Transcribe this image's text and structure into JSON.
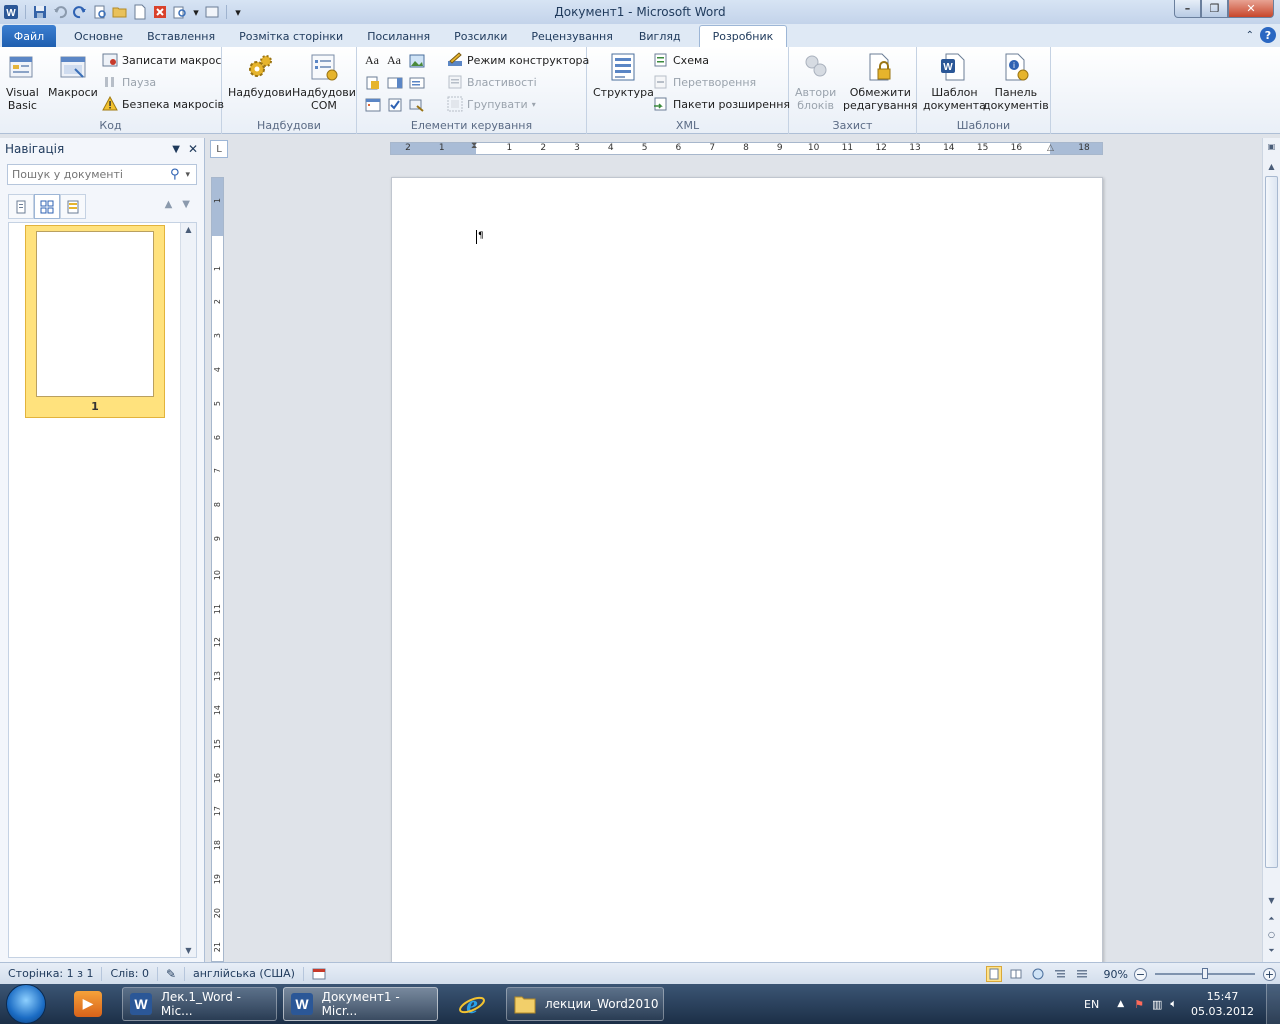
{
  "window": {
    "title": "Документ1  -  Microsoft Word"
  },
  "tabs": {
    "file": "Файл",
    "items": [
      "Основне",
      "Вставлення",
      "Розмітка сторінки",
      "Посилання",
      "Розсилки",
      "Рецензування",
      "Вигляд",
      "Розробник"
    ],
    "active": "Розробник"
  },
  "ribbon": {
    "code": {
      "label": "Код",
      "visual_basic": "Visual\nBasic",
      "macros": "Макроси",
      "record_macro": "Записати макрос",
      "pause": "Пауза",
      "macro_security": "Безпека макросів"
    },
    "addins": {
      "label": "Надбудови",
      "addins_btn": "Надбудови",
      "com_addins": "Надбудови\nCOM"
    },
    "controls": {
      "label": "Елементи керування",
      "design_mode": "Режим конструктора",
      "properties": "Властивості",
      "group": "Групувати"
    },
    "xml": {
      "label": "XML",
      "structure": "Структура",
      "schema": "Схема",
      "transformation": "Перетворення",
      "expansion_packs": "Пакети розширення"
    },
    "protect": {
      "label": "Захист",
      "block_authors": "Автори\nблоків",
      "restrict_editing": "Обмежити\nредагування"
    },
    "templates": {
      "label": "Шаблони",
      "document_template": "Шаблон\nдокумента",
      "document_panel": "Панель\nдокументів"
    }
  },
  "nav": {
    "title": "Навігація",
    "search_placeholder": "Пошук у документі",
    "page_number": "1"
  },
  "ruler": {
    "h_labels": [
      "2",
      "1",
      "",
      "1",
      "2",
      "3",
      "4",
      "5",
      "6",
      "7",
      "8",
      "9",
      "10",
      "11",
      "12",
      "13",
      "14",
      "15",
      "16",
      "",
      "18"
    ],
    "v_labels": [
      "1",
      "",
      "1",
      "2",
      "3",
      "4",
      "5",
      "6",
      "7",
      "8",
      "9",
      "10",
      "11",
      "12",
      "13",
      "14",
      "15",
      "16",
      "17",
      "18",
      "19",
      "20",
      "21"
    ]
  },
  "status": {
    "page": "Сторінка: 1 з 1",
    "words": "Слів: 0",
    "language": "англійська (США)",
    "zoom": "90%",
    "zoom_fraction": 0.5
  },
  "taskbar": {
    "items": [
      {
        "label": "Лек.1_Word - Mic...",
        "icon": "word-icon"
      },
      {
        "label": "Документ1 - Micr...",
        "icon": "word-icon"
      },
      {
        "label": "",
        "icon": "internet-explorer-icon"
      },
      {
        "label": "лекции_Word2010",
        "icon": "folder-icon"
      }
    ],
    "lang": "EN",
    "time": "15:47",
    "date": "05.03.2012"
  },
  "colors": {
    "accent": "#2b6cc4",
    "file_tab": "#2a6ac0",
    "selected_thumb": "#ffe27d"
  }
}
